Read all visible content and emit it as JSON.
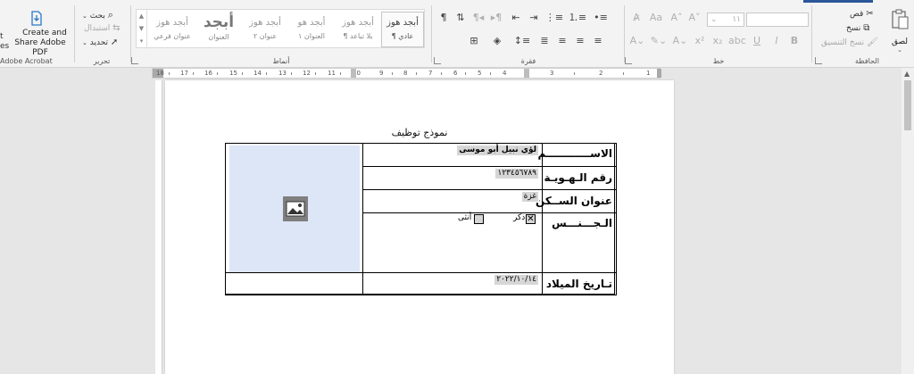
{
  "ribbon": {
    "accent_color": "#2b579a",
    "adobe": {
      "cut_label_line1": "t",
      "cut_label_line2": "es",
      "button_line1": "Create and",
      "button_line2": "Share Adobe PDF",
      "group_label": "Adobe Acrobat"
    },
    "editing": {
      "find": "بحث",
      "replace": "استبدال",
      "select": "تحديد",
      "group_label": "تحرير"
    },
    "styles": {
      "group_label": "أنماط",
      "tiles": [
        {
          "sample": "أبجد هوز",
          "name": "¶ عادي"
        },
        {
          "sample": "أبجد هوز",
          "name": "¶ بلا تباعد"
        },
        {
          "sample": "أبجد هو",
          "name": "العنوان ١"
        },
        {
          "sample": "أبجد هوز",
          "name": "عنوان ٢"
        },
        {
          "sample": "أبجد",
          "name": "العنوان"
        },
        {
          "sample": "أبجد هوز",
          "name": "عنوان فرعي"
        }
      ]
    },
    "paragraph": {
      "group_label": "فقرة"
    },
    "font": {
      "group_label": "خط",
      "size_value": "١١"
    },
    "clipboard": {
      "paste": "لصق",
      "cut": "قص",
      "copy": "نسخ",
      "format_painter": "نسخ التنسيق",
      "group_label": "الحافظة"
    }
  },
  "ruler": {
    "ticks": [
      "18",
      "17",
      "16",
      "15",
      "14",
      "13",
      "12",
      "11",
      "10",
      "9",
      "8",
      "7",
      "6",
      "5",
      "4",
      "3",
      "2",
      "1"
    ]
  },
  "document": {
    "title": "نموذج توظيف",
    "rows": {
      "name_label": "الاســــــــــــم",
      "name_value": "لؤي نبيل أبو موسى",
      "id_label": "رقم الـهـويـة",
      "id_value": "١٢٣٤٥٦٧٨٩",
      "address_label": "عنوان الســكن",
      "address_value": "غزة",
      "gender_label": "الـجـــنـــس",
      "male_label": "ذكر",
      "female_label": "أنثى",
      "birth_label": "تـاريخ الميلاد",
      "birth_value": "٢٠٢٢/١٠/١٤"
    },
    "photo_fill_color": "#dde6f7"
  }
}
